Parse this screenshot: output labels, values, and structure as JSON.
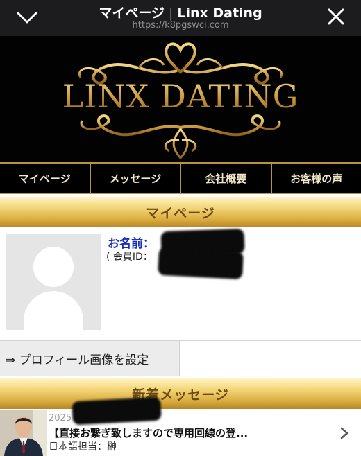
{
  "browser": {
    "title_page": "マイページ",
    "title_sep": "|",
    "title_site": "Linx Dating",
    "url": "https://k8pgswci.com",
    "back_icon": "chevron-down-icon",
    "close_icon": "close-icon"
  },
  "banner": {
    "logo_text": "LINX DATING",
    "accent_color": "#c9973d"
  },
  "nav": {
    "items": [
      {
        "label": "マイページ"
      },
      {
        "label": "メッセージ"
      },
      {
        "label": "会社概要"
      },
      {
        "label": "お客様の声"
      }
    ]
  },
  "mypage": {
    "section_title": "マイページ",
    "name_label": "お名前：",
    "member_id_label": "( 会員ID：",
    "set_image_button": "⇒ プロフィール画像を設定"
  },
  "messages": {
    "section_title": "新着メッセージ",
    "items": [
      {
        "date": "2025",
        "subject": "【直接お繋ぎ致しますので専用回線の登...",
        "sender": "日本語担当：榊"
      }
    ]
  }
}
